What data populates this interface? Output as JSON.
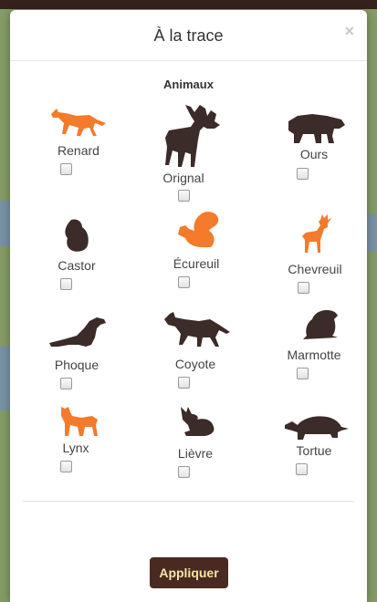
{
  "modal": {
    "title": "À la trace",
    "close_label": "×",
    "section_title": "Animaux",
    "apply_label": "Appliquer"
  },
  "colors": {
    "orange": "#f47a2c",
    "brown": "#3b2b29",
    "button_bg": "#4a2a20",
    "button_text": "#f4e6a6"
  },
  "animals": [
    {
      "label": "Renard",
      "icon": "fox-icon",
      "color": "orange",
      "checked": false
    },
    {
      "label": "Orignal",
      "icon": "moose-icon",
      "color": "brown",
      "checked": false
    },
    {
      "label": "Ours",
      "icon": "bear-icon",
      "color": "brown",
      "checked": false
    },
    {
      "label": "Castor",
      "icon": "beaver-icon",
      "color": "brown",
      "checked": false
    },
    {
      "label": "Écureuil",
      "icon": "squirrel-icon",
      "color": "orange",
      "checked": false
    },
    {
      "label": "Chevreuil",
      "icon": "deer-icon",
      "color": "orange",
      "checked": false
    },
    {
      "label": "Phoque",
      "icon": "seal-icon",
      "color": "brown",
      "checked": false
    },
    {
      "label": "Coyote",
      "icon": "coyote-icon",
      "color": "brown",
      "checked": false
    },
    {
      "label": "Marmotte",
      "icon": "groundhog-icon",
      "color": "brown",
      "checked": false
    },
    {
      "label": "Lynx",
      "icon": "lynx-icon",
      "color": "orange",
      "checked": false
    },
    {
      "label": "Lièvre",
      "icon": "hare-icon",
      "color": "brown",
      "checked": false
    },
    {
      "label": "Tortue",
      "icon": "turtle-icon",
      "color": "brown",
      "checked": false
    }
  ]
}
